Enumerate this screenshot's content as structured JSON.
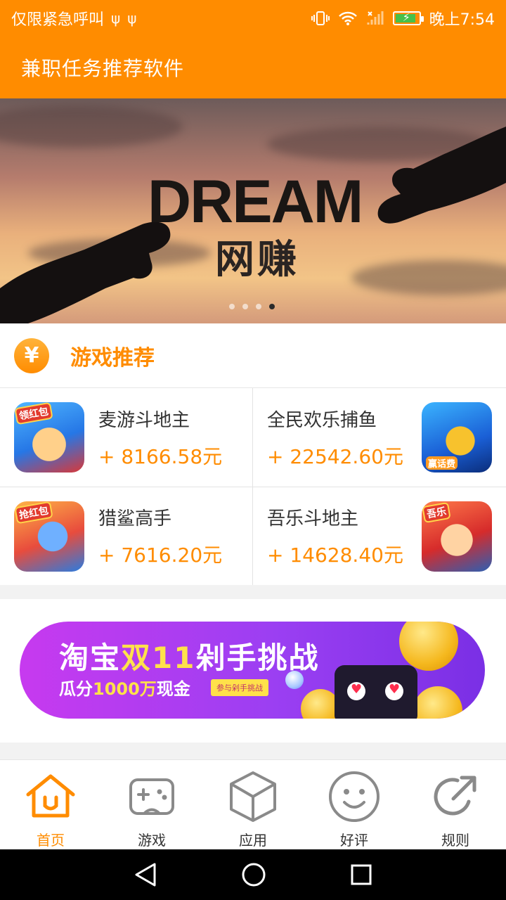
{
  "status_bar": {
    "left_text": "仅限紧急呼叫",
    "time": "晚上7:54",
    "icons": [
      "usb-icon",
      "usb-icon",
      "vibrate-icon",
      "wifi-icon",
      "signal-icon",
      "battery-charging-icon"
    ]
  },
  "app_bar": {
    "title": "兼职任务推荐软件"
  },
  "hero": {
    "title": "DREAM",
    "subtitle": "网赚",
    "slide_count": 4,
    "active_slide": 4
  },
  "section": {
    "icon": "yen-icon",
    "glyph": "¥",
    "title": "游戏推荐"
  },
  "games": [
    {
      "name": "麦游斗地主",
      "reward": "+ 8166.58元",
      "badge": "领红包"
    },
    {
      "name": "全民欢乐捕鱼",
      "reward": "+ 22542.60元",
      "badge": "赢话费"
    },
    {
      "name": "猎鲨高手",
      "reward": "+ 7616.20元",
      "badge": "抢红包"
    },
    {
      "name": "吾乐斗地主",
      "reward": "+ 14628.40元",
      "badge": "吾乐"
    }
  ],
  "promo": {
    "title_pre": "淘宝",
    "title_hl": "双11",
    "title_post": "剁手挑战",
    "sub_pre": "瓜分",
    "sub_hl": "1000万",
    "sub_post": "现金",
    "tag": "参与剁手挑战"
  },
  "bottom_nav": [
    {
      "label": "首页",
      "icon": "home-icon",
      "active": true
    },
    {
      "label": "游戏",
      "icon": "gamepad-icon",
      "active": false
    },
    {
      "label": "应用",
      "icon": "cube-icon",
      "active": false
    },
    {
      "label": "好评",
      "icon": "smiley-icon",
      "active": false
    },
    {
      "label": "规则",
      "icon": "share-arrow-icon",
      "active": false
    }
  ],
  "colors": {
    "accent": "#ff8c00",
    "reward": "#ff8c00",
    "promo_purple": "#9b3ff2",
    "promo_highlight": "#ffe14a"
  }
}
